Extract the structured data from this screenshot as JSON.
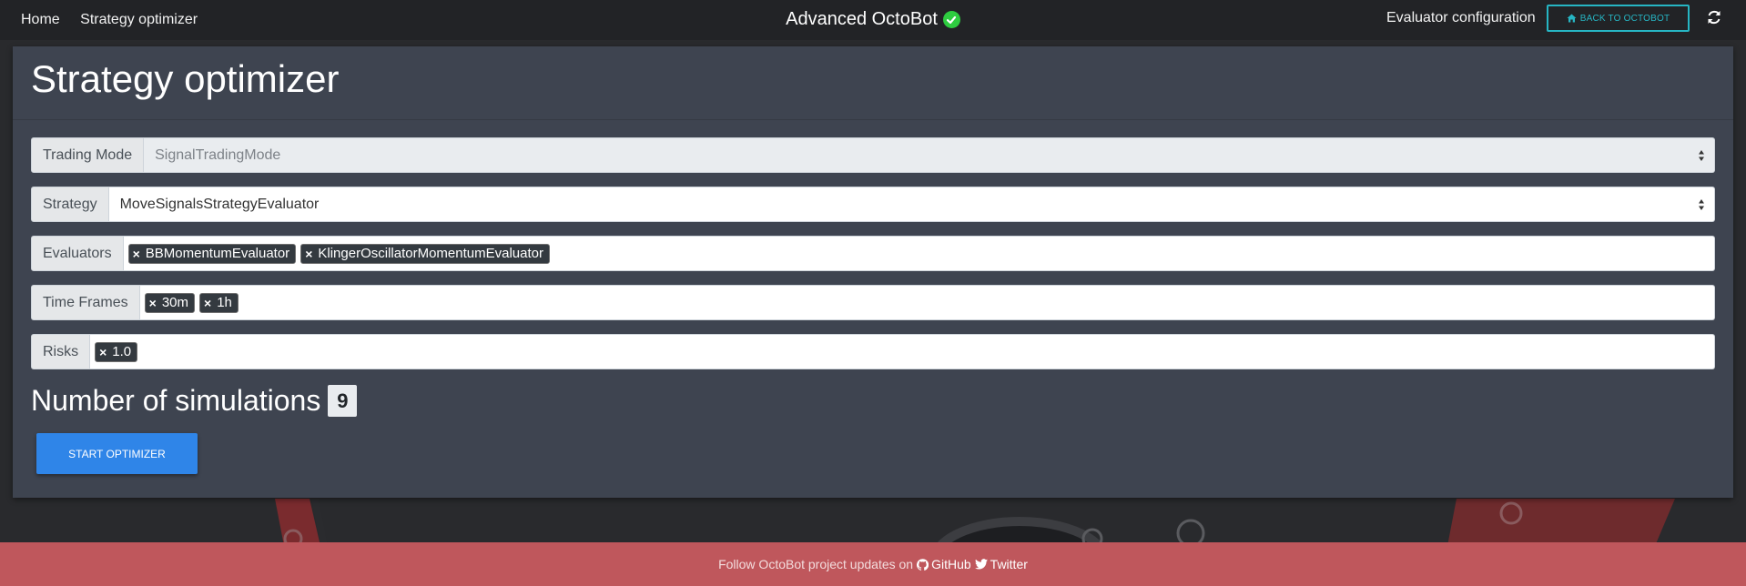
{
  "nav": {
    "home": "Home",
    "strategy_optimizer": "Strategy optimizer",
    "brand": "Advanced OctoBot",
    "evaluator_configuration": "Evaluator configuration",
    "back_button": "BACK TO OCTOBOT"
  },
  "page": {
    "title": "Strategy optimizer"
  },
  "form": {
    "trading_mode": {
      "label": "Trading Mode",
      "value": "SignalTradingMode"
    },
    "strategy": {
      "label": "Strategy",
      "value": "MoveSignalsStrategyEvaluator"
    },
    "evaluators": {
      "label": "Evaluators",
      "tags": [
        "BBMomentumEvaluator",
        "KlingerOscillatorMomentumEvaluator"
      ]
    },
    "time_frames": {
      "label": "Time Frames",
      "tags": [
        "30m",
        "1h"
      ]
    },
    "risks": {
      "label": "Risks",
      "tags": [
        "1.0"
      ]
    }
  },
  "simulations": {
    "label": "Number of simulations",
    "count": "9"
  },
  "start_button": "START OPTIMIZER",
  "footer": {
    "text": "Follow OctoBot project updates on",
    "github": "GitHub",
    "twitter": "Twitter"
  },
  "colors": {
    "accent_teal": "#26b5c3",
    "primary_blue": "#2f85e8",
    "footer_red": "#bf575c",
    "status_green": "#2ecc40"
  },
  "icons": [
    "check-circle-icon",
    "home-icon",
    "refresh-icon",
    "tag-remove-icon",
    "select-arrows-icon",
    "github-icon",
    "twitter-icon"
  ]
}
